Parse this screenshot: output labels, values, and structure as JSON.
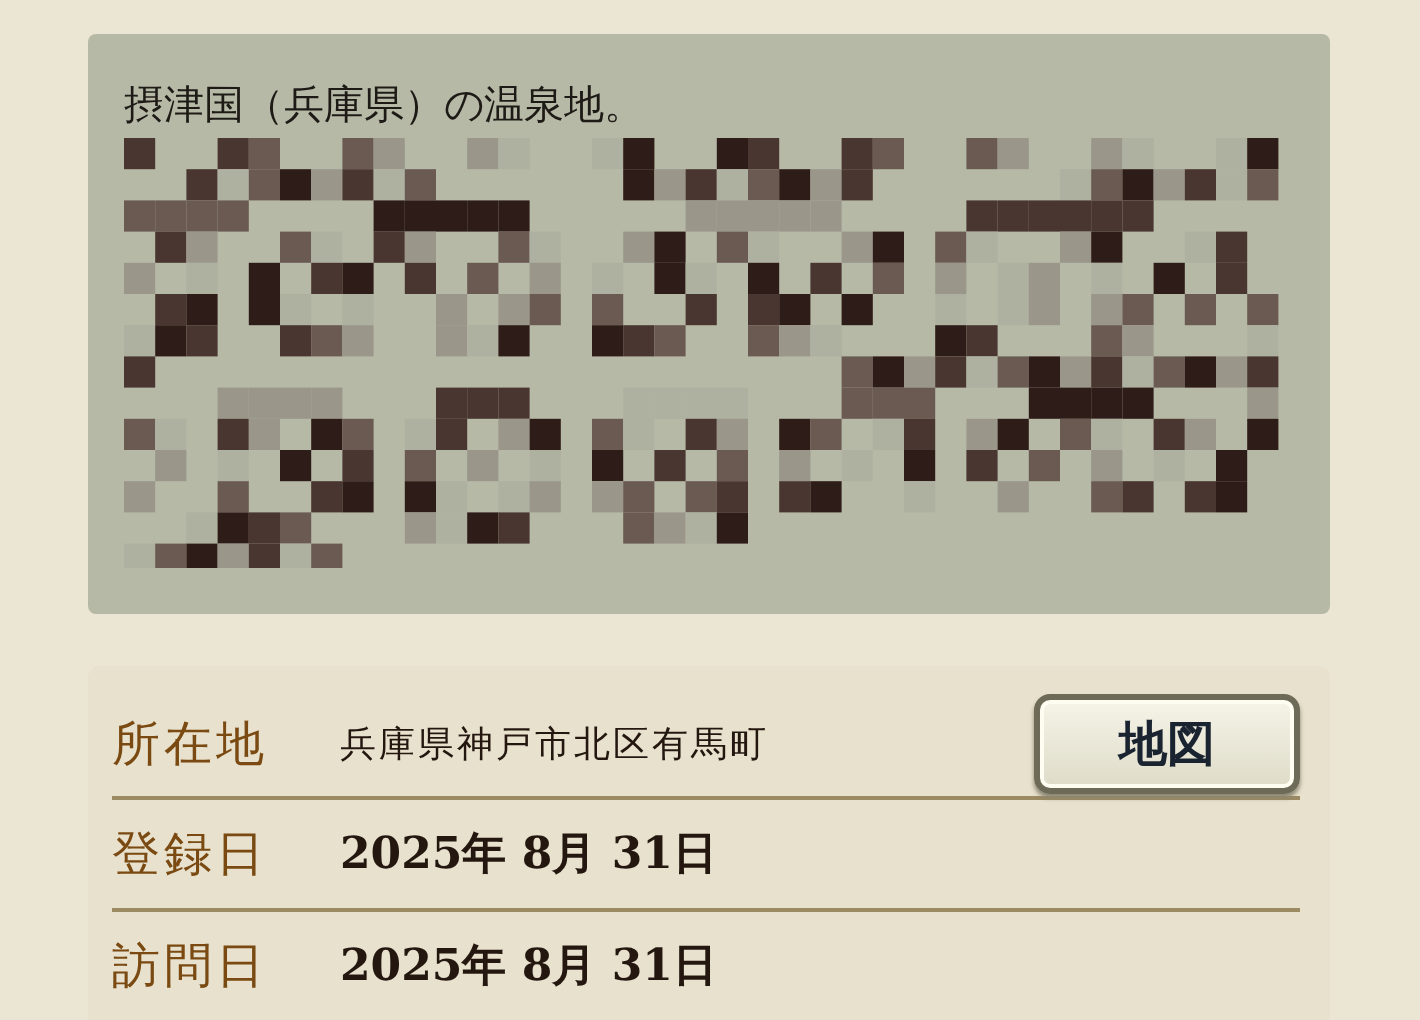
{
  "description": {
    "text": "摂津国（兵庫県）の温泉地。"
  },
  "info_rows": [
    {
      "label": "所在地",
      "value": "兵庫県神戸市北区有馬町",
      "kind": "location",
      "button": "地図"
    },
    {
      "label": "登録日",
      "value": "2025年 8月 31日",
      "kind": "date"
    },
    {
      "label": "訪問日",
      "value": "2025年 8月 31日",
      "kind": "date"
    }
  ]
}
